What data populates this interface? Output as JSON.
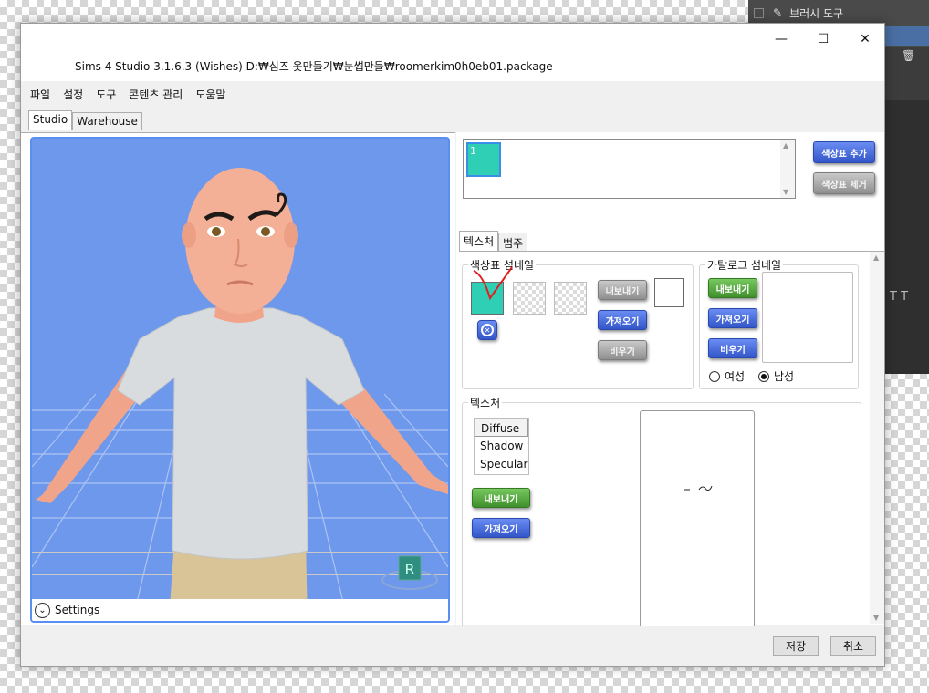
{
  "background_app": {
    "brush_tool_label": "브러시 도구"
  },
  "window": {
    "title": "Sims 4 Studio 3.1.6.3 (Wishes)  D:₩심즈 옷만들기₩눈썹만들₩roomerkim0h0eb01.package",
    "minimize_glyph": "—",
    "maximize_glyph": "☐",
    "close_glyph": "✕"
  },
  "menu": [
    "파일",
    "설정",
    "도구",
    "콘텐츠 관리",
    "도움말"
  ],
  "main_tabs": [
    "Studio",
    "Warehouse"
  ],
  "viewport": {
    "settings_label": "Settings",
    "r_badge": "R",
    "background_color": "#6d98ec"
  },
  "swatches": {
    "items": [
      {
        "label": "1",
        "color": "#2ecfb4"
      }
    ],
    "add_label": "색상표 추가",
    "remove_label": "색상표 제거"
  },
  "sub_tabs": [
    "텍스처",
    "범주"
  ],
  "swatch_thumbnail": {
    "group_label": "색상표 섬네일",
    "export_label": "내보내기",
    "import_label": "가져오기",
    "clear_label": "비우기"
  },
  "catalog_thumbnail": {
    "group_label": "카탈로그 섬네일",
    "export_label": "내보내기",
    "import_label": "가져오기",
    "clear_label": "비우기",
    "gender_options": [
      {
        "label": "여성",
        "selected": false
      },
      {
        "label": "남성",
        "selected": true
      }
    ]
  },
  "texture": {
    "group_label": "텍스처",
    "types": [
      {
        "label": "Diffuse",
        "selected": true
      },
      {
        "label": "Shadow",
        "selected": false
      },
      {
        "label": "Specular",
        "selected": false
      }
    ],
    "export_label": "내보내기",
    "import_label": "가져오기"
  },
  "footer": {
    "save_label": "저장",
    "cancel_label": "취소"
  }
}
